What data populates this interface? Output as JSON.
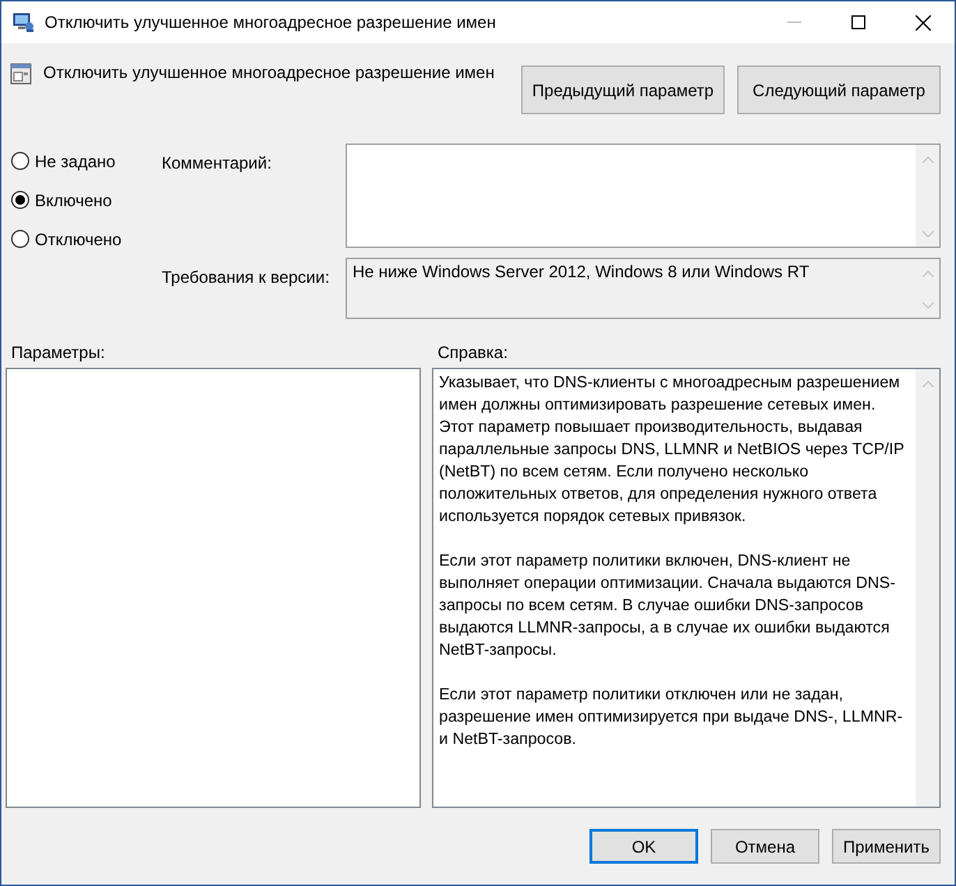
{
  "window": {
    "title": "Отключить улучшенное многоадресное разрешение имен"
  },
  "header": {
    "policy_name": "Отключить улучшенное многоадресное разрешение имен",
    "buttons": [
      "Предыдущий параметр",
      "Следующий параметр"
    ]
  },
  "state_options": [
    {
      "label": "Не задано",
      "selected": false
    },
    {
      "label": "Включено",
      "selected": true
    },
    {
      "label": "Отключено",
      "selected": false
    }
  ],
  "comment": {
    "label": "Комментарий:"
  },
  "requirements": {
    "label": "Требования к версии:",
    "value": "Не ниже Windows Server 2012, Windows 8 или Windows RT"
  },
  "options_label": "Параметры:",
  "help_label": "Справка:",
  "help_paragraphs": [
    [
      "Указывает, что DNS-клиенты с многоадресным разрешением",
      "имен должны оптимизировать разрешение сетевых имен.",
      "Этот параметр повышает производительность, выдавая",
      "параллельные запросы DNS, LLMNR и NetBIOS через TCP/IP",
      "(NetBT) по всем сетям. Если получено несколько",
      "положительных ответов, для определения нужного ответа",
      "используется порядок сетевых привязок."
    ],
    [
      "Если этот параметр политики включен, DNS-клиент не",
      "выполняет операции оптимизации.  Сначала выдаются DNS-",
      "запросы по всем сетям. В случае ошибки DNS-запросов",
      "выдаются LLMNR-запросы, а в случае их ошибки выдаются",
      "NetBT-запросы."
    ],
    [
      "Если этот параметр политики отключен или не задан,",
      "разрешение имен оптимизируется при выдаче DNS-, LLMNR-",
      "и NetBT-запросов."
    ]
  ],
  "footer_buttons": [
    {
      "label": "OK",
      "default": true
    },
    {
      "label": "Отмена",
      "default": false
    },
    {
      "label": "Применить",
      "default": false
    }
  ]
}
